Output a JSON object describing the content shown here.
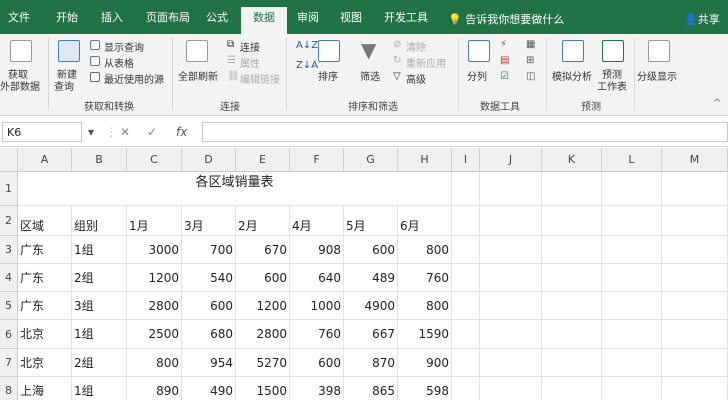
{
  "tabs": [
    "文件",
    "开始",
    "插入",
    "页面布局",
    "公式",
    "数据",
    "审阅",
    "视图",
    "开发工具"
  ],
  "active_tab": "数据",
  "tell_me": "告诉我你想要做什么",
  "share": "共享",
  "ribbon": {
    "get_data": [
      "获取",
      "外部数据"
    ],
    "new_query": [
      "新建",
      "查询"
    ],
    "show_queries": "显示查询",
    "from_table": "从表格",
    "recent_sources": "最近使用的源",
    "group_get_transform": "获取和转换",
    "refresh_all": "全部刷新",
    "connections": "连接",
    "properties": "属性",
    "edit_links": "编辑链接",
    "group_connections": "连接",
    "sort": "排序",
    "filter": "筛选",
    "clear": "清除",
    "reapply": "重新应用",
    "advanced": "高级",
    "group_sort_filter": "排序和筛选",
    "text_to_columns": "分列",
    "group_data_tools": "数据工具",
    "what_if": "模拟分析",
    "forecast_sheet": [
      "预测",
      "工作表"
    ],
    "group_forecast": "预测",
    "outline": "分级显示"
  },
  "formula_bar": {
    "name_box": "K6",
    "formula": ""
  },
  "columns": [
    "A",
    "B",
    "C",
    "D",
    "E",
    "F",
    "G",
    "H",
    "I",
    "J",
    "K",
    "L",
    "M"
  ],
  "rows": [
    "1",
    "2",
    "3",
    "4",
    "5",
    "6",
    "7",
    "8"
  ],
  "sheet": {
    "title": "各区域销量表",
    "headers": [
      "区域",
      "组别",
      "1月",
      "3月",
      "2月",
      "4月",
      "5月",
      "6月"
    ],
    "data": [
      [
        "广东",
        "1组",
        "3000",
        "700",
        "670",
        "908",
        "600",
        "800"
      ],
      [
        "广东",
        "2组",
        "1200",
        "540",
        "600",
        "640",
        "489",
        "760"
      ],
      [
        "广东",
        "3组",
        "2800",
        "600",
        "1200",
        "1000",
        "4900",
        "800"
      ],
      [
        "北京",
        "1组",
        "2500",
        "680",
        "2800",
        "760",
        "667",
        "1590"
      ],
      [
        "北京",
        "2组",
        "800",
        "954",
        "5270",
        "600",
        "870",
        "900"
      ],
      [
        "上海",
        "1组",
        "890",
        "490",
        "1500",
        "398",
        "865",
        "598"
      ]
    ]
  },
  "colors": {
    "brand": "#217346",
    "ribbon_bg": "#f3f3f3"
  }
}
